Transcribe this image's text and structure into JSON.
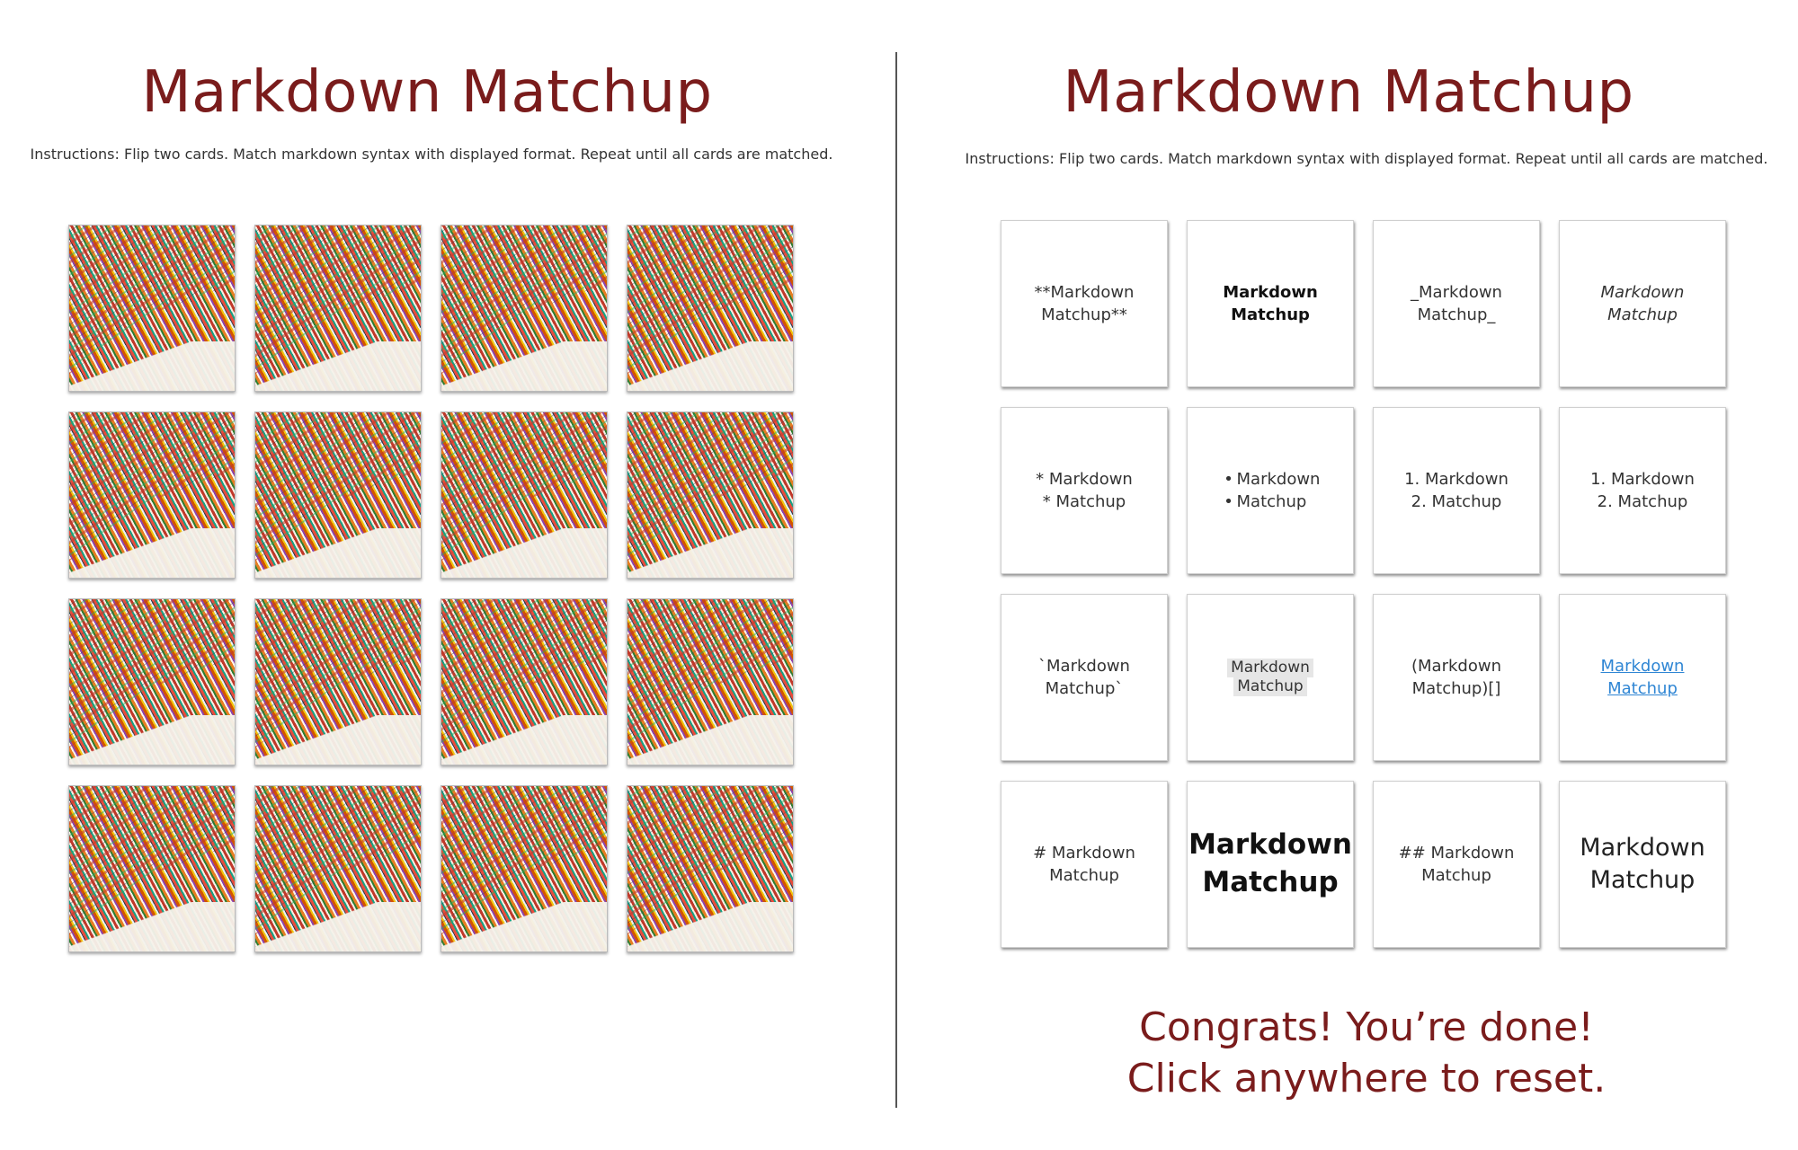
{
  "left": {
    "title": "Markdown Matchup",
    "instructions": "Instructions: Flip two cards. Match markdown syntax with displayed format. Repeat until all cards are matched.",
    "card_count": 16
  },
  "right": {
    "title": "Markdown Matchup",
    "instructions": "Instructions: Flip two cards. Match markdown syntax with displayed format. Repeat until all cards are matched.",
    "cards": {
      "c1": "**Markdown\nMatchup**",
      "c2": "Markdown\nMatchup",
      "c3": "_Markdown\nMatchup_",
      "c4": "Markdown\nMatchup",
      "c5": "* Markdown\n* Matchup",
      "c6a": "Markdown",
      "c6b": "Matchup",
      "c7": "1. Markdown\n2. Matchup",
      "c8": "1. Markdown\n2. Matchup",
      "c9": "`Markdown\nMatchup`",
      "c10a": "Markdown",
      "c10b": "Matchup",
      "c11": "(Markdown\nMatchup)[]",
      "c12": "Markdown\nMatchup",
      "c13": "# Markdown\nMatchup",
      "c14": "Markdown\nMatchup",
      "c15": "## Markdown\nMatchup",
      "c16": "Markdown\nMatchup"
    },
    "congrats_line1": "Congrats! You’re done!",
    "congrats_line2": "Click anywhere to reset."
  },
  "colors": {
    "title": "#7a1c1c",
    "link": "#2f86d4"
  }
}
